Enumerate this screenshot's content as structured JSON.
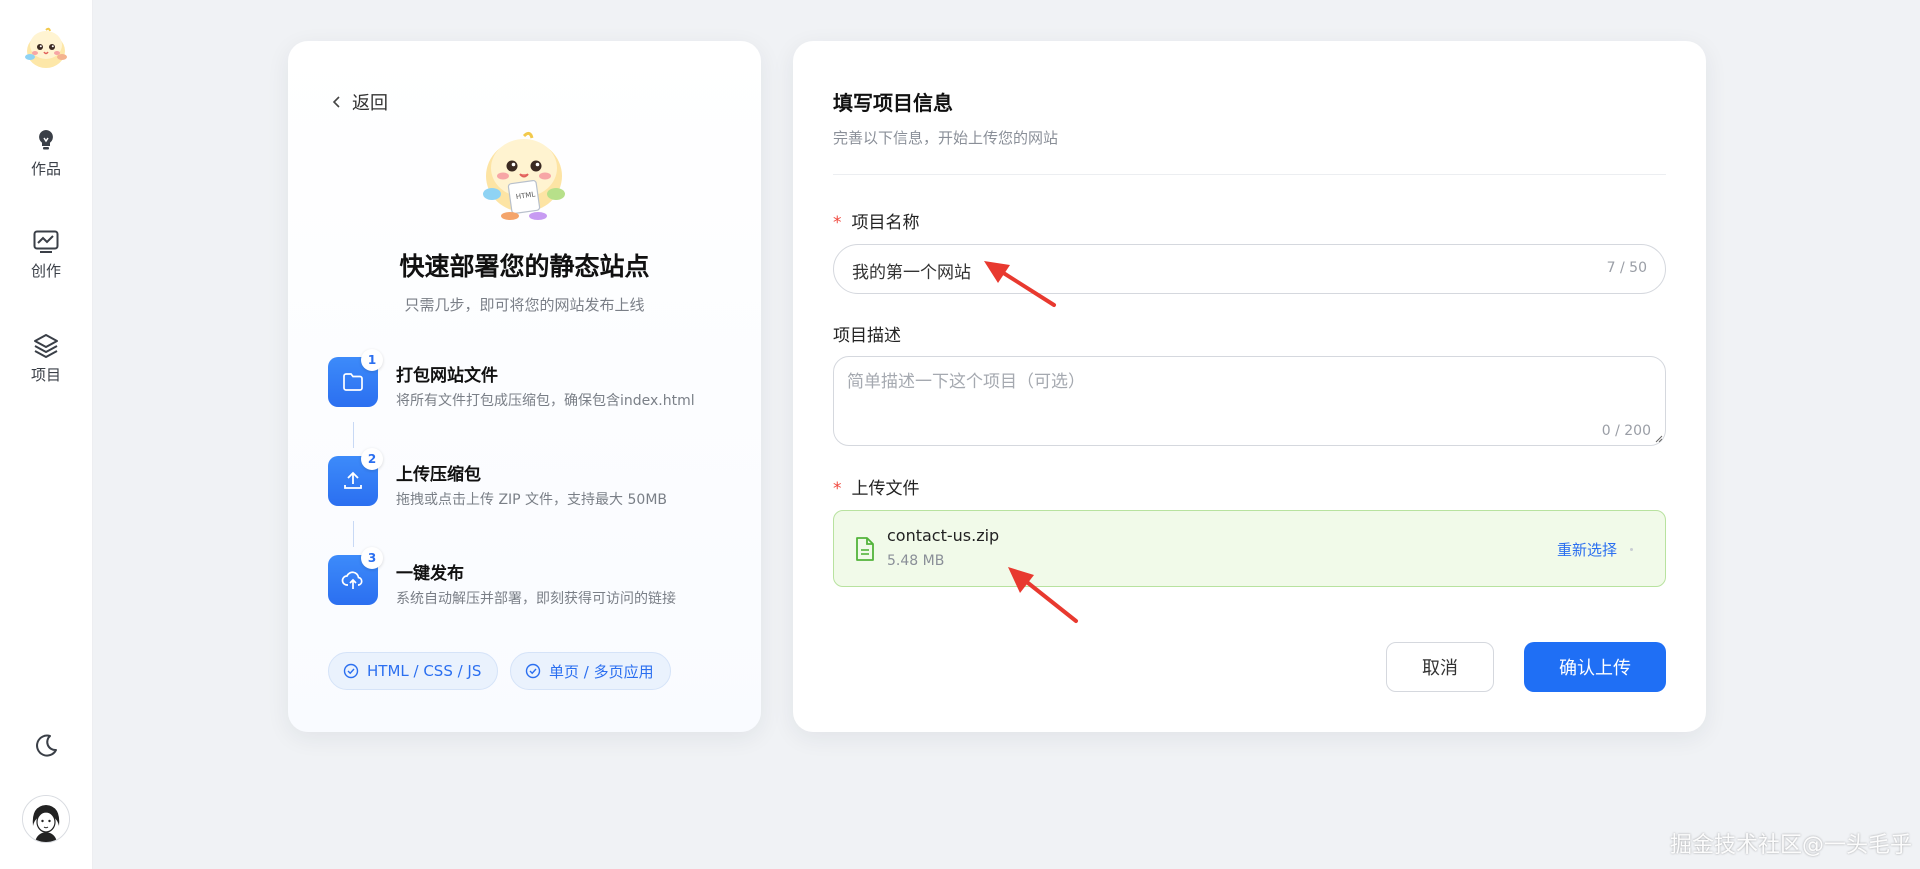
{
  "sidebar": {
    "items": [
      {
        "label": "作品",
        "icon": "lightbulb-icon"
      },
      {
        "label": "创作",
        "icon": "chart-monitor-icon"
      },
      {
        "label": "项目",
        "icon": "layers-icon"
      }
    ],
    "theme_icon": "moon-icon"
  },
  "intro": {
    "back_label": "返回",
    "title": "快速部署您的静态站点",
    "subtitle": "只需几步，即可将您的网站发布上线",
    "steps": [
      {
        "num": "1",
        "title": "打包网站文件",
        "desc": "将所有文件打包成压缩包，确保包含index.html",
        "icon": "folder-icon"
      },
      {
        "num": "2",
        "title": "上传压缩包",
        "desc": "拖拽或点击上传 ZIP 文件，支持最大 50MB",
        "icon": "upload-icon"
      },
      {
        "num": "3",
        "title": "一键发布",
        "desc": "系统自动解压并部署，即刻获得可访问的链接",
        "icon": "cloud-upload-icon"
      }
    ],
    "tags": [
      "HTML / CSS / JS",
      "单页 / 多页应用"
    ]
  },
  "form": {
    "title": "填写项目信息",
    "subtitle": "完善以下信息，开始上传您的网站",
    "name_label": "项目名称",
    "name_value": "我的第一个网站",
    "name_count": "7 / 50",
    "desc_label": "项目描述",
    "desc_placeholder": "简单描述一下这个项目（可选）",
    "desc_count": "0 / 200",
    "file_label": "上传文件",
    "file_name": "contact-us.zip",
    "file_size": "5.48 MB",
    "reselect_label": "重新选择",
    "cancel_label": "取消",
    "confirm_label": "确认上传"
  },
  "watermark": "掘金技术社区@一头毛乎",
  "colors": {
    "primary": "#1f6ff5",
    "success_bg": "#f1fae9",
    "success_border": "#b8e29f",
    "required": "#f0483e",
    "annotation_arrow": "#e8392f"
  }
}
